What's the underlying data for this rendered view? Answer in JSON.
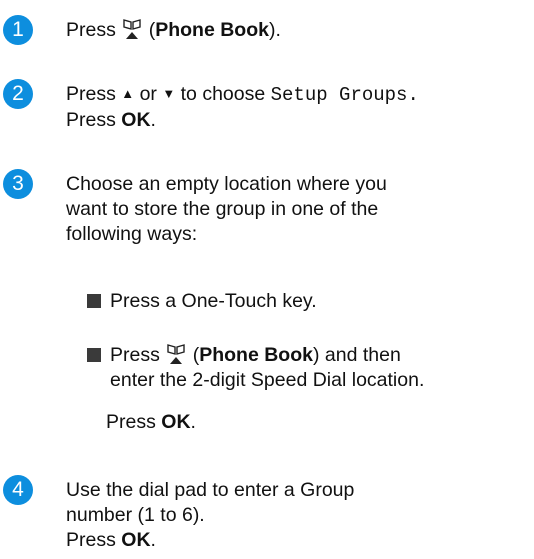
{
  "steps": [
    {
      "number": "1",
      "press": "Press",
      "open_paren": "(",
      "phone_book": "Phone Book",
      "close_paren": ")."
    },
    {
      "number": "2",
      "press": "Press",
      "up_arrow": "▲",
      "or": "or",
      "down_arrow": "▼",
      "to_choose": "to choose",
      "menu_item": "Setup Groups.",
      "press2": "Press",
      "ok": "OK",
      "period": "."
    },
    {
      "number": "3",
      "line1": "Choose an empty location where you",
      "line2": "want to store the group in one of the",
      "line3": "following ways:",
      "bullet1": "Press a One-Touch key.",
      "bullet2_press": "Press",
      "bullet2_open": "(",
      "bullet2_phone_book": "Phone Book",
      "bullet2_after": ") and then",
      "bullet2_line2": "enter the 2-digit Speed Dial location.",
      "press_ok_press": "Press",
      "press_ok_ok": "OK",
      "press_ok_period": "."
    },
    {
      "number": "4",
      "line1": "Use the dial pad to enter a Group",
      "line2": "number (1 to 6).",
      "press": "Press",
      "ok": "OK",
      "period": "."
    }
  ],
  "icons": {
    "phone_book": "phone-book-icon",
    "bullet": "square-bullet-icon"
  },
  "colors": {
    "step_badge": "#0d8ede",
    "text": "#111111",
    "bullet": "#3a3a3a"
  }
}
